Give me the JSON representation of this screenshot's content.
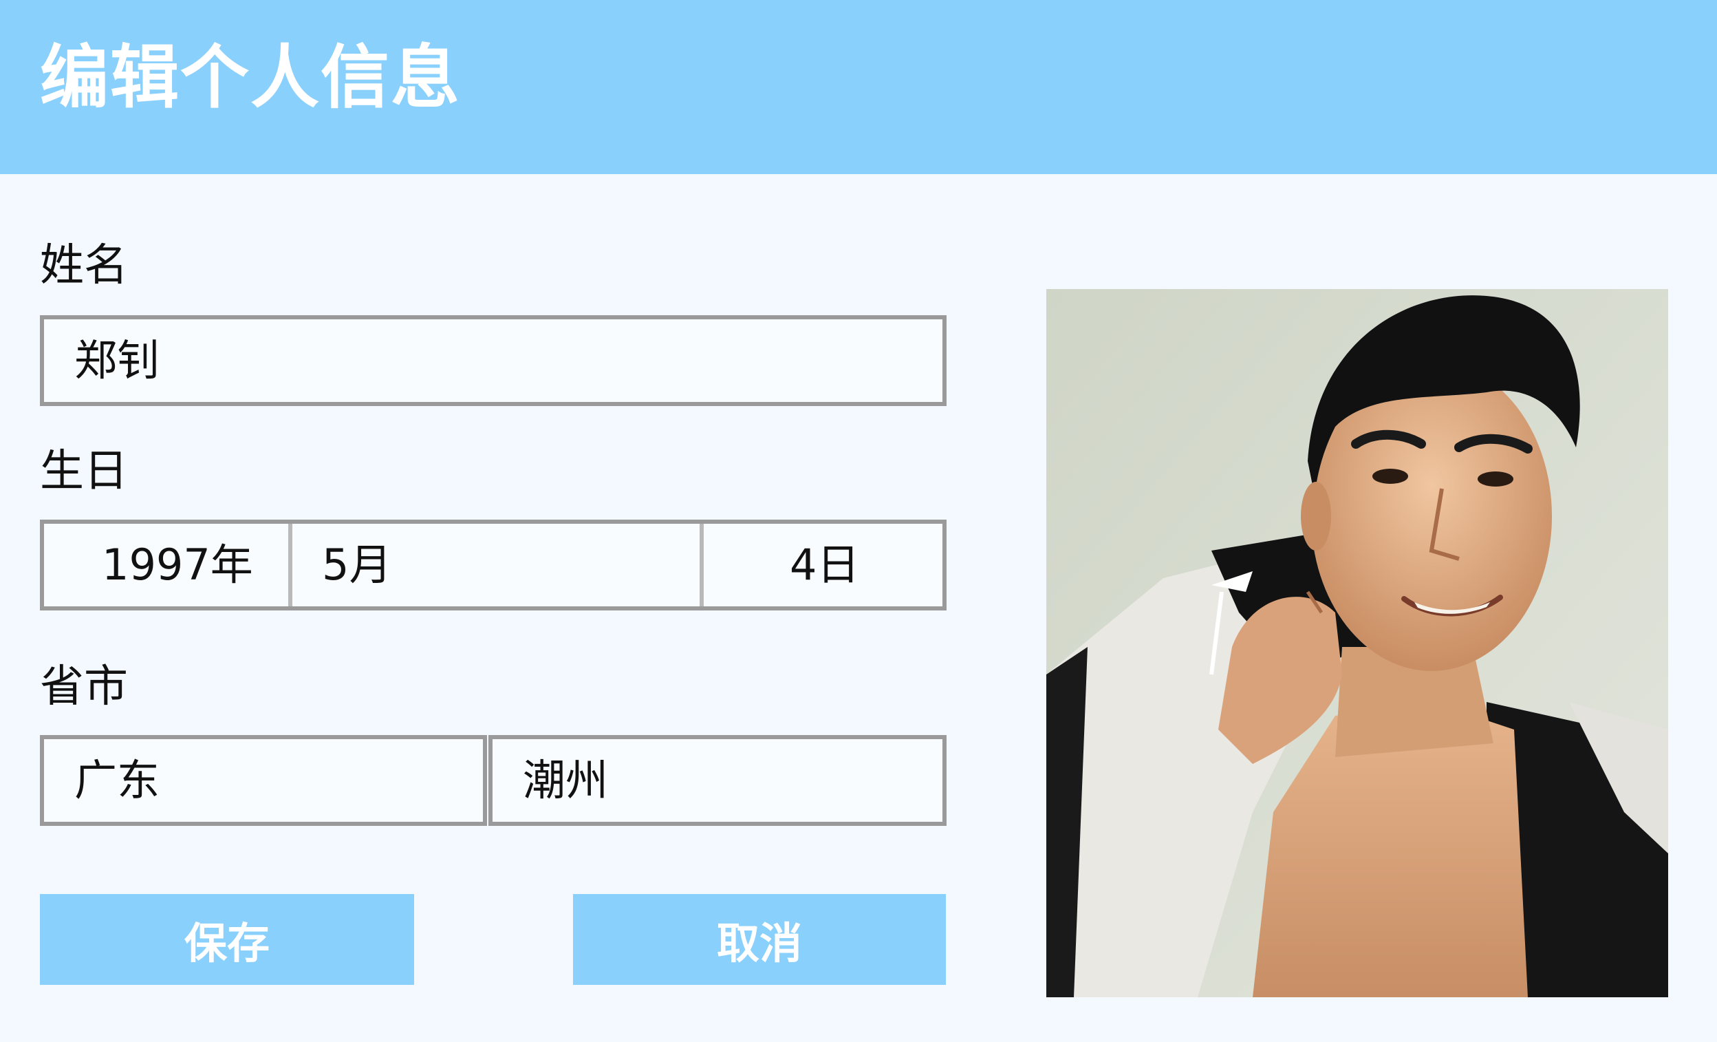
{
  "header": {
    "title": "编辑个人信息"
  },
  "form": {
    "name": {
      "label": "姓名",
      "value": "郑钊"
    },
    "birthday": {
      "label": "生日",
      "year": "1997年",
      "month": "5月",
      "day": "4日"
    },
    "location": {
      "label": "省市",
      "province": "广东",
      "city": "潮州"
    }
  },
  "buttons": {
    "save_label": "保存",
    "cancel_label": "取消"
  },
  "photo": {
    "subject": "portrait-photo"
  },
  "colors": {
    "header_bg": "#8ad0fc",
    "button_bg": "#8ad0fc",
    "page_bg": "#f3f9fe",
    "field_border": "#9a9a9a"
  }
}
